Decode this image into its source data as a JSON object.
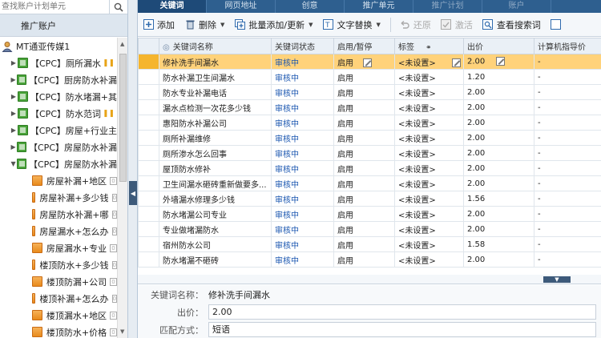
{
  "left": {
    "search_placeholder": "查找账户计划单元",
    "account_header": "推广账户",
    "account_name": "MT通亚传媒1",
    "plans": [
      {
        "label": "【CPC】厕所漏水",
        "paused": true
      },
      {
        "label": "【CPC】厨房防水补漏",
        "paused": false
      },
      {
        "label": "【CPC】防水堵漏+其",
        "paused": false
      },
      {
        "label": "【CPC】防水范词",
        "paused": true
      },
      {
        "label": "【CPC】房屋+行业主",
        "paused": false
      },
      {
        "label": "【CPC】房屋防水补漏",
        "paused": false
      },
      {
        "label": "【CPC】房屋防水补漏",
        "paused": false,
        "expanded": true
      }
    ],
    "units": [
      {
        "label": "房屋补漏+地区",
        "badge": "0"
      },
      {
        "label": "房屋补漏+多少钱",
        "badge": "0"
      },
      {
        "label": "房屋防水补漏+哪",
        "badge": "0"
      },
      {
        "label": "房屋漏水+怎么办",
        "badge": "0"
      },
      {
        "label": "房屋漏水+专业",
        "badge": "0"
      },
      {
        "label": "楼顶防水+多少钱",
        "badge": "0"
      },
      {
        "label": "楼顶防漏+公司",
        "badge": "0"
      },
      {
        "label": "楼顶补漏+怎么办",
        "badge": "0"
      },
      {
        "label": "楼顶漏水+地区",
        "badge": "0"
      },
      {
        "label": "楼顶防水+价格",
        "badge": "0"
      }
    ]
  },
  "tabs": [
    {
      "label": "关键词",
      "active": true
    },
    {
      "label": "网页地址"
    },
    {
      "label": "创意"
    },
    {
      "label": "推广单元"
    },
    {
      "label": "推广计划"
    },
    {
      "label": "账户"
    }
  ],
  "toolbar": {
    "add": "添加",
    "delete": "删除",
    "batch": "批量添加/更新",
    "replace": "文字替换",
    "restore": "还原",
    "activate": "激活",
    "search_words": "查看搜索词"
  },
  "grid": {
    "headers": [
      "",
      "关键词名称",
      "关键词状态",
      "启用/暂停",
      "标签",
      "出价",
      "计算机指导价"
    ],
    "sort_mark": "◎",
    "rows": [
      {
        "keyword": "修补洗手间漏水",
        "status": "审核中",
        "enabled": "启用",
        "tag": "<未设置>",
        "bid": "2.00",
        "guide": "-",
        "selected": true
      },
      {
        "keyword": "防水补漏卫生间漏水",
        "status": "审核中",
        "enabled": "启用",
        "tag": "<未设置>",
        "bid": "1.20",
        "guide": "-"
      },
      {
        "keyword": "防水专业补漏电话",
        "status": "审核中",
        "enabled": "启用",
        "tag": "<未设置>",
        "bid": "2.00",
        "guide": "-"
      },
      {
        "keyword": "漏水点检测一次花多少钱",
        "status": "审核中",
        "enabled": "启用",
        "tag": "<未设置>",
        "bid": "2.00",
        "guide": "-"
      },
      {
        "keyword": "惠阳防水补漏公司",
        "status": "审核中",
        "enabled": "启用",
        "tag": "<未设置>",
        "bid": "2.00",
        "guide": "-"
      },
      {
        "keyword": "厕所补漏维修",
        "status": "审核中",
        "enabled": "启用",
        "tag": "<未设置>",
        "bid": "2.00",
        "guide": "-"
      },
      {
        "keyword": "厕所渗水怎么回事",
        "status": "审核中",
        "enabled": "启用",
        "tag": "<未设置>",
        "bid": "2.00",
        "guide": "-"
      },
      {
        "keyword": "屋顶防水修补",
        "status": "审核中",
        "enabled": "启用",
        "tag": "<未设置>",
        "bid": "2.00",
        "guide": "-"
      },
      {
        "keyword": "卫生间漏水砸砖重新做要多...",
        "status": "审核中",
        "enabled": "启用",
        "tag": "<未设置>",
        "bid": "2.00",
        "guide": "-"
      },
      {
        "keyword": "外墙漏水修理多少钱",
        "status": "审核中",
        "enabled": "启用",
        "tag": "<未设置>",
        "bid": "1.56",
        "guide": "-"
      },
      {
        "keyword": "防水堵漏公司专业",
        "status": "审核中",
        "enabled": "启用",
        "tag": "<未设置>",
        "bid": "2.00",
        "guide": "-"
      },
      {
        "keyword": "专业做堵漏防水",
        "status": "审核中",
        "enabled": "启用",
        "tag": "<未设置>",
        "bid": "2.00",
        "guide": "-"
      },
      {
        "keyword": "宿州防水公司",
        "status": "审核中",
        "enabled": "启用",
        "tag": "<未设置>",
        "bid": "1.58",
        "guide": "-"
      },
      {
        "keyword": "防水堵漏不砸砖",
        "status": "审核中",
        "enabled": "启用",
        "tag": "<未设置>",
        "bid": "2.00",
        "guide": "-"
      }
    ]
  },
  "detail": {
    "keyword_label": "关键词名称：",
    "keyword_value": "修补洗手间漏水",
    "bid_label": "出价：",
    "bid_value": "2.00",
    "match_label": "匹配方式：",
    "match_value": "短语"
  }
}
